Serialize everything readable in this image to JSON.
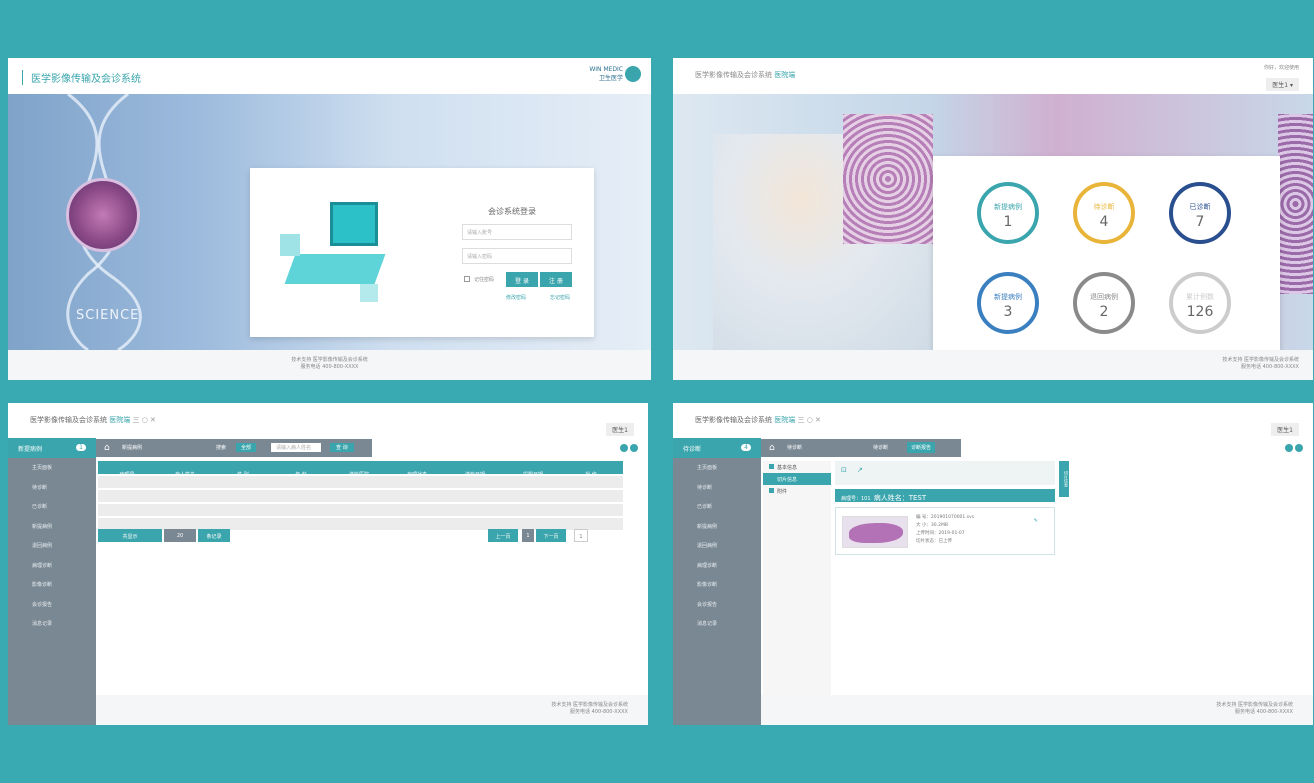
{
  "panel1": {
    "app_title": "医学影像传输及会诊系统",
    "logo_text_en": "WIN MEDIC",
    "logo_text_cn": "卫生医学",
    "hero_word": "SCIENCE",
    "login": {
      "title": "会诊系统登录",
      "username_placeholder": "请输入账号",
      "password_placeholder": "请输入密码",
      "remember_label": "记住密码",
      "login_button": "登 录",
      "register_button": "注 册",
      "link_left": "修改密码",
      "link_right": "忘记密码"
    },
    "footer_line1": "技术支持 医学影像传输及会诊系统",
    "footer_line2": "服务电话 400-800-XXXX"
  },
  "panel2": {
    "app_title": "医学影像传输及会诊系统",
    "role_label": "医院端",
    "top_right": "你好，欢迎使用",
    "user_menu": "医生1 ▾",
    "stats": [
      {
        "label": "新提病例",
        "value": "1",
        "color": "#3aa5ad"
      },
      {
        "label": "待诊断",
        "value": "4",
        "color": "#e8b53a"
      },
      {
        "label": "已诊断",
        "value": "7",
        "color": "#2a4f8f"
      },
      {
        "label": "新提病例",
        "value": "3",
        "color": "#3a7fc0"
      },
      {
        "label": "退回病例",
        "value": "2",
        "color": "#8a8a8a"
      },
      {
        "label": "累计例数",
        "value": "126",
        "color": "#cccccc"
      }
    ],
    "footer_line1": "技术支持 医学影像传输及会诊系统",
    "footer_line2": "服务电话 400-800-XXXX"
  },
  "panel3": {
    "app_title": "医学影像传输及会诊系统",
    "role_label": "医院端",
    "window_controls": "三 ○ ✕",
    "user_button": "医生1",
    "sidebar_top": "新提病例",
    "sidebar_badge": "1",
    "sidebar_items": [
      "主页面板",
      "待诊断",
      "已诊断",
      "新提病例",
      "退回病例",
      "病理诊断",
      "影像诊断",
      "会诊报告",
      "消息记录"
    ],
    "breadcrumb": "新提病例",
    "search_label": "搜索",
    "search_select": "全部",
    "search_placeholder": "请输入病人姓名",
    "search_button": "查 询",
    "columns": [
      "病理号",
      "病人姓名",
      "性 别",
      "年 龄",
      "送检医院",
      "病理状态",
      "送检日期",
      "提醒日期",
      "操 作"
    ],
    "page_info": "共显示",
    "page_size": "20",
    "page_unit": "条记录",
    "prev_button": "上一页",
    "current_page": "1",
    "next_button": "下一页",
    "jump_value": "1",
    "footer_line1": "技术支持 医学影像传输及会诊系统",
    "footer_line2": "服务电话 400-800-XXXX"
  },
  "panel4": {
    "app_title": "医学影像传输及会诊系统",
    "role_label": "医院端",
    "window_controls": "三 ○ ✕",
    "user_button": "医生1",
    "sidebar_top": "待诊断",
    "sidebar_badge": "4",
    "sidebar_items": [
      "主页面板",
      "待诊断",
      "已诊断",
      "新提病例",
      "退回病例",
      "病理诊断",
      "影像诊断",
      "会诊报告",
      "消息记录"
    ],
    "breadcrumb": "待诊断",
    "tab1": "待诊断",
    "tab2": "诊断报告",
    "tree_items": [
      "基本信息",
      "切片信息",
      "附件"
    ],
    "case_header_no": "病理号：101",
    "case_header_name": "病人姓名：TEST",
    "slide_info": [
      "编  号：201901070001.svs",
      "大  小：30.2MB",
      "上传时间：2019-01-07",
      "切片状态：已上传"
    ],
    "side_tab": "切片信息",
    "footer_line1": "技术支持 医学影像传输及会诊系统",
    "footer_line2": "服务电话 400-800-XXXX"
  }
}
